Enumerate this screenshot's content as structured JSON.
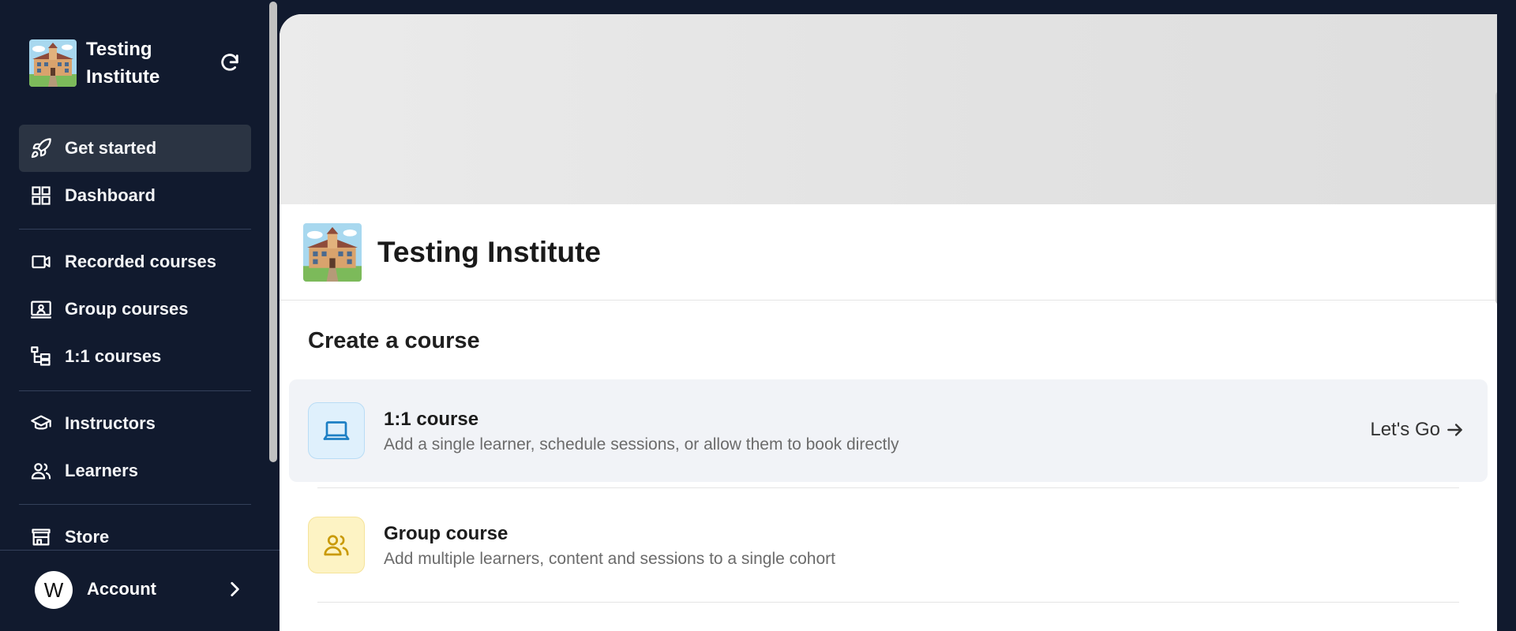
{
  "sidebar": {
    "org_name": "Testing Institute",
    "nav": [
      {
        "label": "Get started",
        "icon": "rocket-icon",
        "active": true
      },
      {
        "label": "Dashboard",
        "icon": "grid-icon"
      },
      {
        "label": "Recorded courses",
        "icon": "video-icon"
      },
      {
        "label": "Group courses",
        "icon": "presentation-icon"
      },
      {
        "label": "1:1 courses",
        "icon": "hierarchy-icon"
      },
      {
        "label": "Instructors",
        "icon": "graduation-cap-icon"
      },
      {
        "label": "Learners",
        "icon": "users-icon"
      },
      {
        "label": "Store",
        "icon": "store-icon"
      }
    ],
    "account": {
      "initial": "W",
      "label": "Account"
    }
  },
  "main": {
    "institute_name": "Testing Institute",
    "section_title": "Create a course",
    "courses": [
      {
        "title": "1:1 course",
        "description": "Add a single learner, schedule sessions, or allow them to book directly",
        "action": "Let's Go",
        "icon": "laptop-icon"
      },
      {
        "title": "Group course",
        "description": "Add multiple learners, content and sessions to a single cohort",
        "icon": "users-icon"
      }
    ]
  },
  "colors": {
    "sidebar_bg": "#111a2e",
    "active_nav_bg": "#2b3443",
    "one_on_one_icon": "#1d7fc4",
    "group_icon": "#c99a07"
  }
}
